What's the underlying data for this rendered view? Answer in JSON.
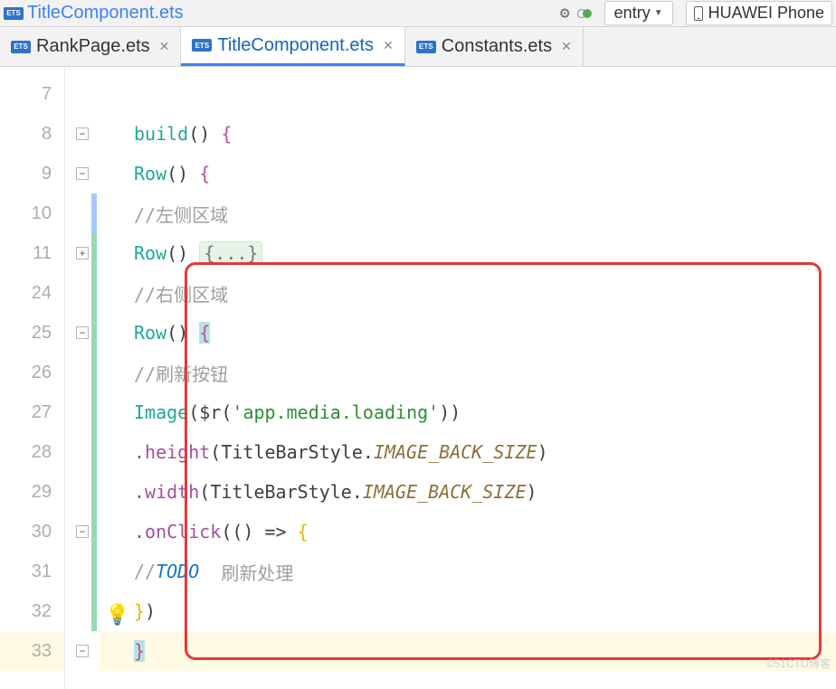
{
  "topbar": {
    "filename": "TitleComponent.ets",
    "config": "entry",
    "device": "HUAWEI Phone"
  },
  "tabs": [
    {
      "label": "RankPage.ets",
      "active": false
    },
    {
      "label": "TitleComponent.ets",
      "active": true
    },
    {
      "label": "Constants.ets",
      "active": false
    }
  ],
  "lines": {
    "l7": {
      "num": "7",
      "code": ""
    },
    "l8": {
      "num": "8",
      "fn": "build",
      "p": "() ",
      "b": "{"
    },
    "l9": {
      "num": "9",
      "fn": "Row",
      "p": "() ",
      "b": "{"
    },
    "l10": {
      "num": "10",
      "c": "//左侧区域"
    },
    "l11": {
      "num": "11",
      "fn": "Row",
      "p": "() ",
      "dots": "{...}"
    },
    "l24": {
      "num": "24",
      "c": "//右侧区域"
    },
    "l25": {
      "num": "25",
      "fn": "Row",
      "p": "() ",
      "b": "{"
    },
    "l26": {
      "num": "26",
      "c": "//刷新按钮"
    },
    "l27": {
      "num": "27",
      "fn": "Image",
      "op": "(",
      "dollar": "$r",
      "op2": "(",
      "str": "'app.media.loading'",
      "cp": "))"
    },
    "l28": {
      "num": "28",
      "dot": ".",
      "m": "height",
      "op": "(",
      "v": "TitleBarStyle",
      "dot2": ".",
      "k": "IMAGE_BACK_SIZE",
      "cp": ")"
    },
    "l29": {
      "num": "29",
      "dot": ".",
      "m": "width",
      "op": "(",
      "v": "TitleBarStyle",
      "dot2": ".",
      "k": "IMAGE_BACK_SIZE",
      "cp": ")"
    },
    "l30": {
      "num": "30",
      "dot": ".",
      "m": "onClick",
      "op": "(() ",
      "arrow": "=>",
      "sp": " ",
      "b": "{"
    },
    "l31": {
      "num": "31",
      "cc": "//",
      "todo": "TODO",
      "rest": "  刷新处理"
    },
    "l32": {
      "num": "32",
      "cb": "}",
      "cp": ")"
    },
    "l33": {
      "num": "33",
      "cb": "}"
    }
  },
  "watermark": "©51CTO博客"
}
